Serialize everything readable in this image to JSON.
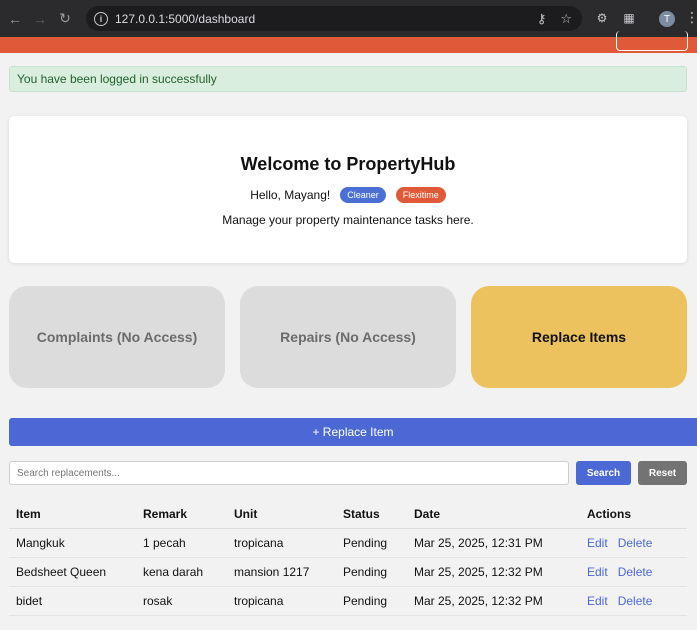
{
  "browser": {
    "url": "127.0.0.1:5000/dashboard",
    "avatar_letter": "T"
  },
  "alert": {
    "message": "You have been logged in successfully"
  },
  "welcome": {
    "title": "Welcome to PropertyHub",
    "greeting": "Hello, Mayang!",
    "badges": [
      "Cleaner",
      "Flexitime"
    ],
    "subtitle": "Manage your property maintenance tasks here."
  },
  "tiles": [
    {
      "label": "Complaints (No Access)"
    },
    {
      "label": "Repairs (No Access)"
    },
    {
      "label": "Replace Items"
    }
  ],
  "replace_button": {
    "label": "+ Replace Item"
  },
  "search": {
    "placeholder": "Search replacements...",
    "search_label": "Search",
    "reset_label": "Reset"
  },
  "table": {
    "headers": [
      "Item",
      "Remark",
      "Unit",
      "Status",
      "Date",
      "Actions"
    ],
    "rows": [
      {
        "item": "Mangkuk",
        "remark": "1 pecah",
        "unit": "tropicana",
        "status": "Pending",
        "date": "Mar 25, 2025, 12:31 PM"
      },
      {
        "item": "Bedsheet Queen",
        "remark": "kena darah",
        "unit": "mansion 1217",
        "status": "Pending",
        "date": "Mar 25, 2025, 12:32 PM"
      },
      {
        "item": "bidet",
        "remark": "rosak",
        "unit": "tropicana",
        "status": "Pending",
        "date": "Mar 25, 2025, 12:32 PM"
      }
    ],
    "edit_label": "Edit",
    "delete_label": "Delete"
  },
  "colors": {
    "brand_orange": "#e05a3a",
    "primary_blue": "#4c68d4",
    "tile_active": "#ebc25e",
    "alert_bg": "#d9eede"
  }
}
